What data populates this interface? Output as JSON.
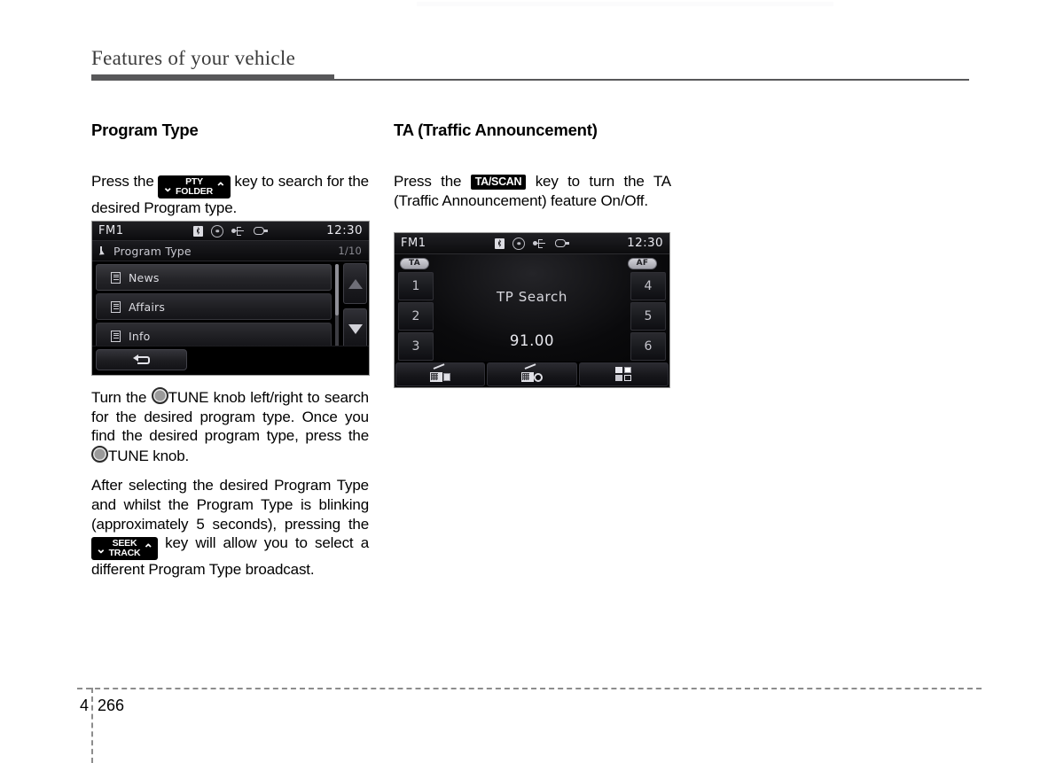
{
  "header": {
    "title": "Features of your vehicle"
  },
  "left_column": {
    "section_title": "Program Type",
    "intro": {
      "before": "Press the",
      "key": {
        "top": "PTY",
        "bottom": "FOLDER",
        "left_chevron": "⌄",
        "right_chevron": "⌃"
      },
      "after": "key to search for the desired Program type."
    },
    "screen": {
      "status": {
        "source": "FM1",
        "time": "12:30",
        "icons": [
          "bluetooth-icon",
          "disc-icon",
          "usb-icon",
          "ipod-icon"
        ]
      },
      "list_header": {
        "pointer_icon": "pointer-icon",
        "title": "Program Type",
        "pager": "1/10"
      },
      "rows": [
        {
          "icon": "document-icon",
          "label": "News"
        },
        {
          "icon": "document-icon",
          "label": "Affairs"
        },
        {
          "icon": "document-icon",
          "label": "Info"
        }
      ],
      "scroll": {
        "up_icon": "triangle-up-icon",
        "down_icon": "triangle-down-icon"
      },
      "back_button": {
        "icon": "back-arrow-icon"
      }
    },
    "para_tune": {
      "p1": "Turn the",
      "knob1": "TUNE",
      "p2": "knob left/right to search for the desired program type. Once you find the desired program type, press the",
      "knob2": "TUNE",
      "p3": "knob."
    },
    "para_seek": {
      "p1": "After selecting the desired Program Type and whilst the Program Type is blinking (approximately 5 seconds), pressing the",
      "key": {
        "top": "SEEK",
        "bottom": "TRACK",
        "left_chevron": "⌄",
        "right_chevron": "⌃"
      },
      "p2": "key will allow you to select a different Program Type broadcast."
    }
  },
  "right_column": {
    "section_title": "TA (Traffic Announcement)",
    "intro": {
      "before": "Press the",
      "key_label": "TA/SCAN",
      "after": "key to turn the TA (Traffic Announcement) feature On/Off."
    },
    "screen": {
      "status": {
        "source": "FM1",
        "time": "12:30",
        "icons": [
          "bluetooth-icon",
          "disc-icon",
          "usb-icon",
          "ipod-icon"
        ]
      },
      "badges": {
        "ta": "TA",
        "af": "AF"
      },
      "presets_left": [
        "1",
        "2",
        "3"
      ],
      "presets_right": [
        "4",
        "5",
        "6"
      ],
      "status_text": "TP Search",
      "frequency": "91.00",
      "toolbar": [
        {
          "icon": "radio-list-icon"
        },
        {
          "icon": "radio-scan-icon"
        },
        {
          "icon": "grid-four-icon"
        }
      ]
    }
  },
  "footer": {
    "chapter": "4",
    "page": "266"
  },
  "colors": {
    "rule": "#58585a",
    "header_text": "#3b3b3b",
    "body_text": "#000000",
    "screen_bg": "#000000",
    "screen_text": "#dcdce2",
    "badge_bg": "#c0c0c8"
  }
}
